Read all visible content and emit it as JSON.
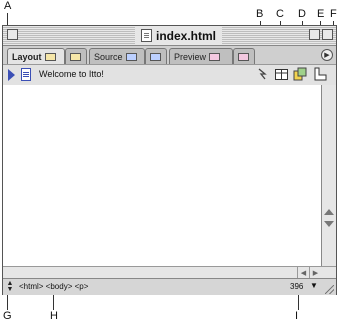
{
  "callouts": {
    "A": "A",
    "B": "B",
    "C": "C",
    "D": "D",
    "E": "E",
    "F": "F",
    "G": "G",
    "H": "H",
    "I": "I"
  },
  "window": {
    "title": "index.html",
    "title_icon": "html-document-icon"
  },
  "tabs": [
    {
      "label": "Layout",
      "icon": "layout-view-icon",
      "active": true
    },
    {
      "label": "",
      "icon": "layout-alt-icon",
      "active": false
    },
    {
      "label": "Source",
      "icon": "source-view-icon",
      "active": false
    },
    {
      "label": "",
      "icon": "source-alt-icon",
      "active": false
    },
    {
      "label": "Preview",
      "icon": "preview-view-icon",
      "active": false
    },
    {
      "label": "",
      "icon": "preview-alt-icon",
      "active": false
    }
  ],
  "toolbar": {
    "page_title": "Welcome to Itto!",
    "icons": [
      "link-warning-icon",
      "table-icon",
      "object-icon",
      "page-properties-icon"
    ]
  },
  "status": {
    "tag_path": "<html> <body> <p>",
    "window_width": "396"
  }
}
